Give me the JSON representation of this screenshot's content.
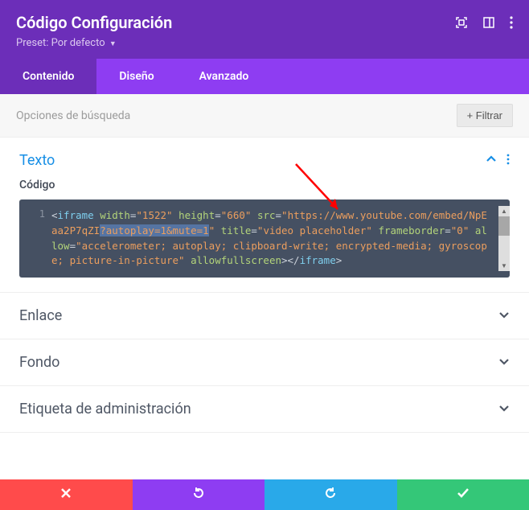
{
  "header": {
    "title": "Código Configuración",
    "preset_label": "Preset:",
    "preset_value": "Por defecto"
  },
  "tabs": {
    "content": "Contenido",
    "design": "Diseño",
    "advanced": "Avanzado"
  },
  "search": {
    "placeholder": "Opciones de búsqueda",
    "filter_btn": "Filtrar"
  },
  "sections": {
    "text": {
      "title": "Texto",
      "field_label": "Código"
    },
    "link": {
      "title": "Enlace"
    },
    "background": {
      "title": "Fondo"
    },
    "admin_label": {
      "title": "Etiqueta de administración"
    }
  },
  "code": {
    "line_no": "1",
    "tokens": {
      "tag_open": "<iframe",
      "attr_width": "width",
      "val_width": "\"1522\"",
      "attr_height": "height",
      "val_height": "\"660\"",
      "attr_src": "src",
      "val_src_base": "\"https://www.youtube.com/embed/NpEaa2P7qZI",
      "val_src_query": "?autoplay=1&mute=1",
      "val_src_close": "\"",
      "attr_title": "title",
      "val_title": "\"video placeholder\"",
      "attr_frameborder": "frameborder",
      "val_frameborder": "\"0\"",
      "attr_allow": "allow",
      "val_allow": "\"accelerometer; autoplay; clipboard-write; encrypted-media; gyroscope; picture-in-picture\"",
      "attr_allowfs": "allowfullscreen",
      "tag_close": "></iframe>"
    }
  }
}
